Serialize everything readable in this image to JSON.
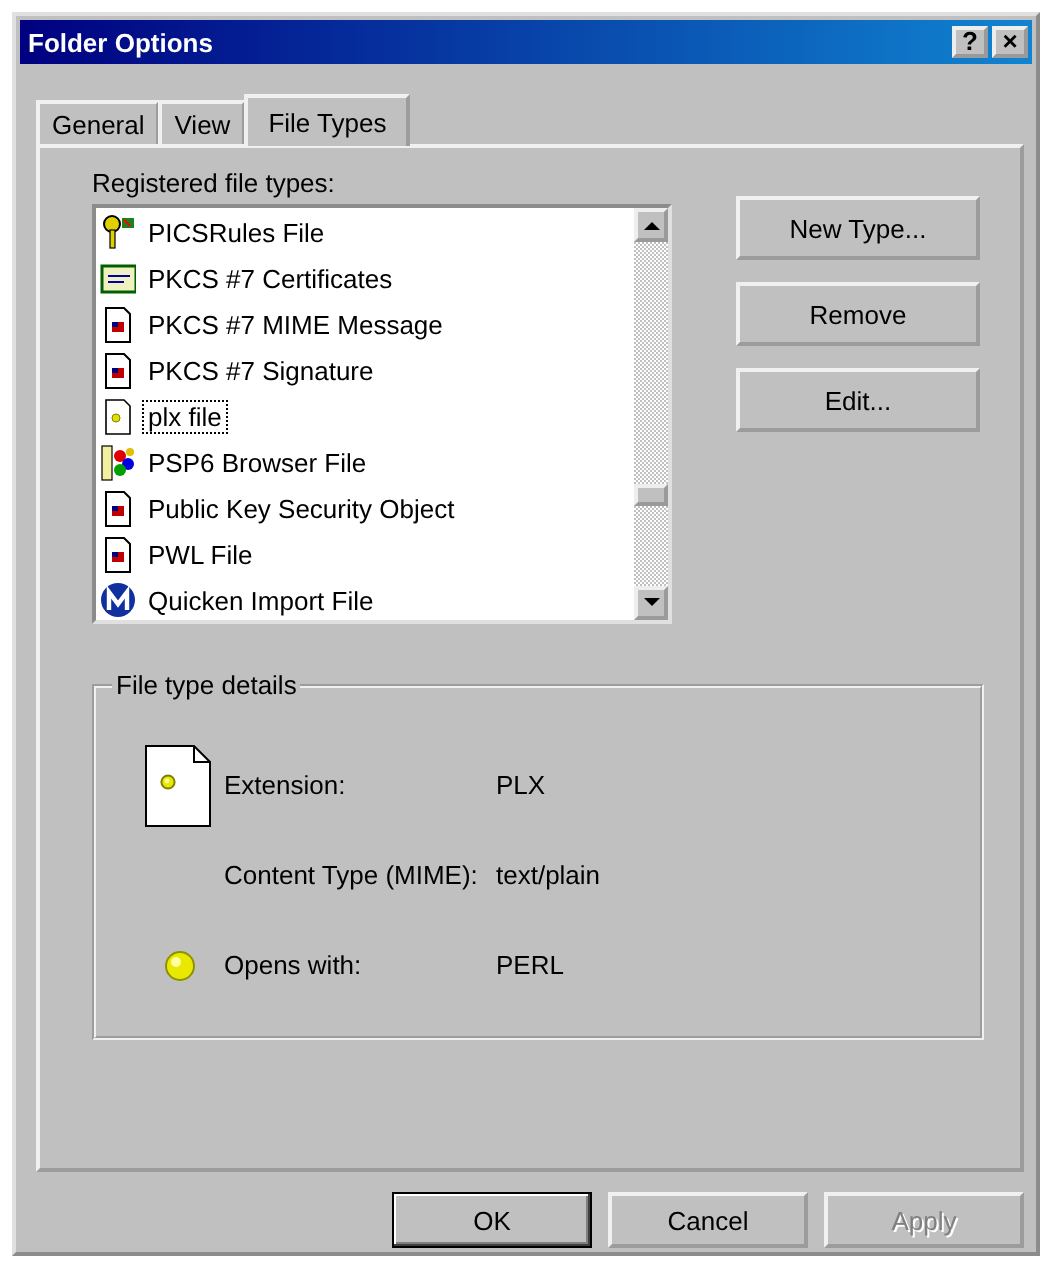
{
  "window": {
    "title": "Folder Options",
    "title_buttons": [
      "?",
      "×"
    ]
  },
  "tabs": [
    {
      "label": "General",
      "selected": false
    },
    {
      "label": "View",
      "selected": false
    },
    {
      "label": "File Types",
      "selected": true
    }
  ],
  "file_list": {
    "label": "Registered file types:",
    "items": [
      {
        "name": "PICSRules File",
        "kind": "key",
        "focused": false
      },
      {
        "name": "PKCS #7 Certificates",
        "kind": "certificate",
        "focused": false
      },
      {
        "name": "PKCS #7 MIME Message",
        "kind": "document",
        "focused": false
      },
      {
        "name": "PKCS #7 Signature",
        "kind": "document",
        "focused": false
      },
      {
        "name": "plx file",
        "kind": "plx",
        "focused": true
      },
      {
        "name": "PSP6 Browser File",
        "kind": "palette",
        "focused": false
      },
      {
        "name": "Public Key Security Object",
        "kind": "document",
        "focused": false
      },
      {
        "name": "PWL File",
        "kind": "document",
        "focused": false
      },
      {
        "name": "Quicken Import File",
        "kind": "quicken",
        "focused": false
      }
    ]
  },
  "side_buttons": [
    "New Type...",
    "Remove",
    "Edit..."
  ],
  "details": {
    "title": "File type details",
    "rows": [
      {
        "kind": "plx",
        "label": "Extension:",
        "value": "PLX"
      },
      {
        "label": "Content Type (MIME):",
        "value": "text/plain"
      },
      {
        "kind": "ball",
        "label": "Opens with:",
        "value": "PERL"
      }
    ]
  },
  "buttons": [
    {
      "label": "OK",
      "default": true,
      "disabled": false
    },
    {
      "label": "Cancel",
      "default": false,
      "disabled": false
    },
    {
      "label": "Apply",
      "default": false,
      "disabled": true
    }
  ]
}
